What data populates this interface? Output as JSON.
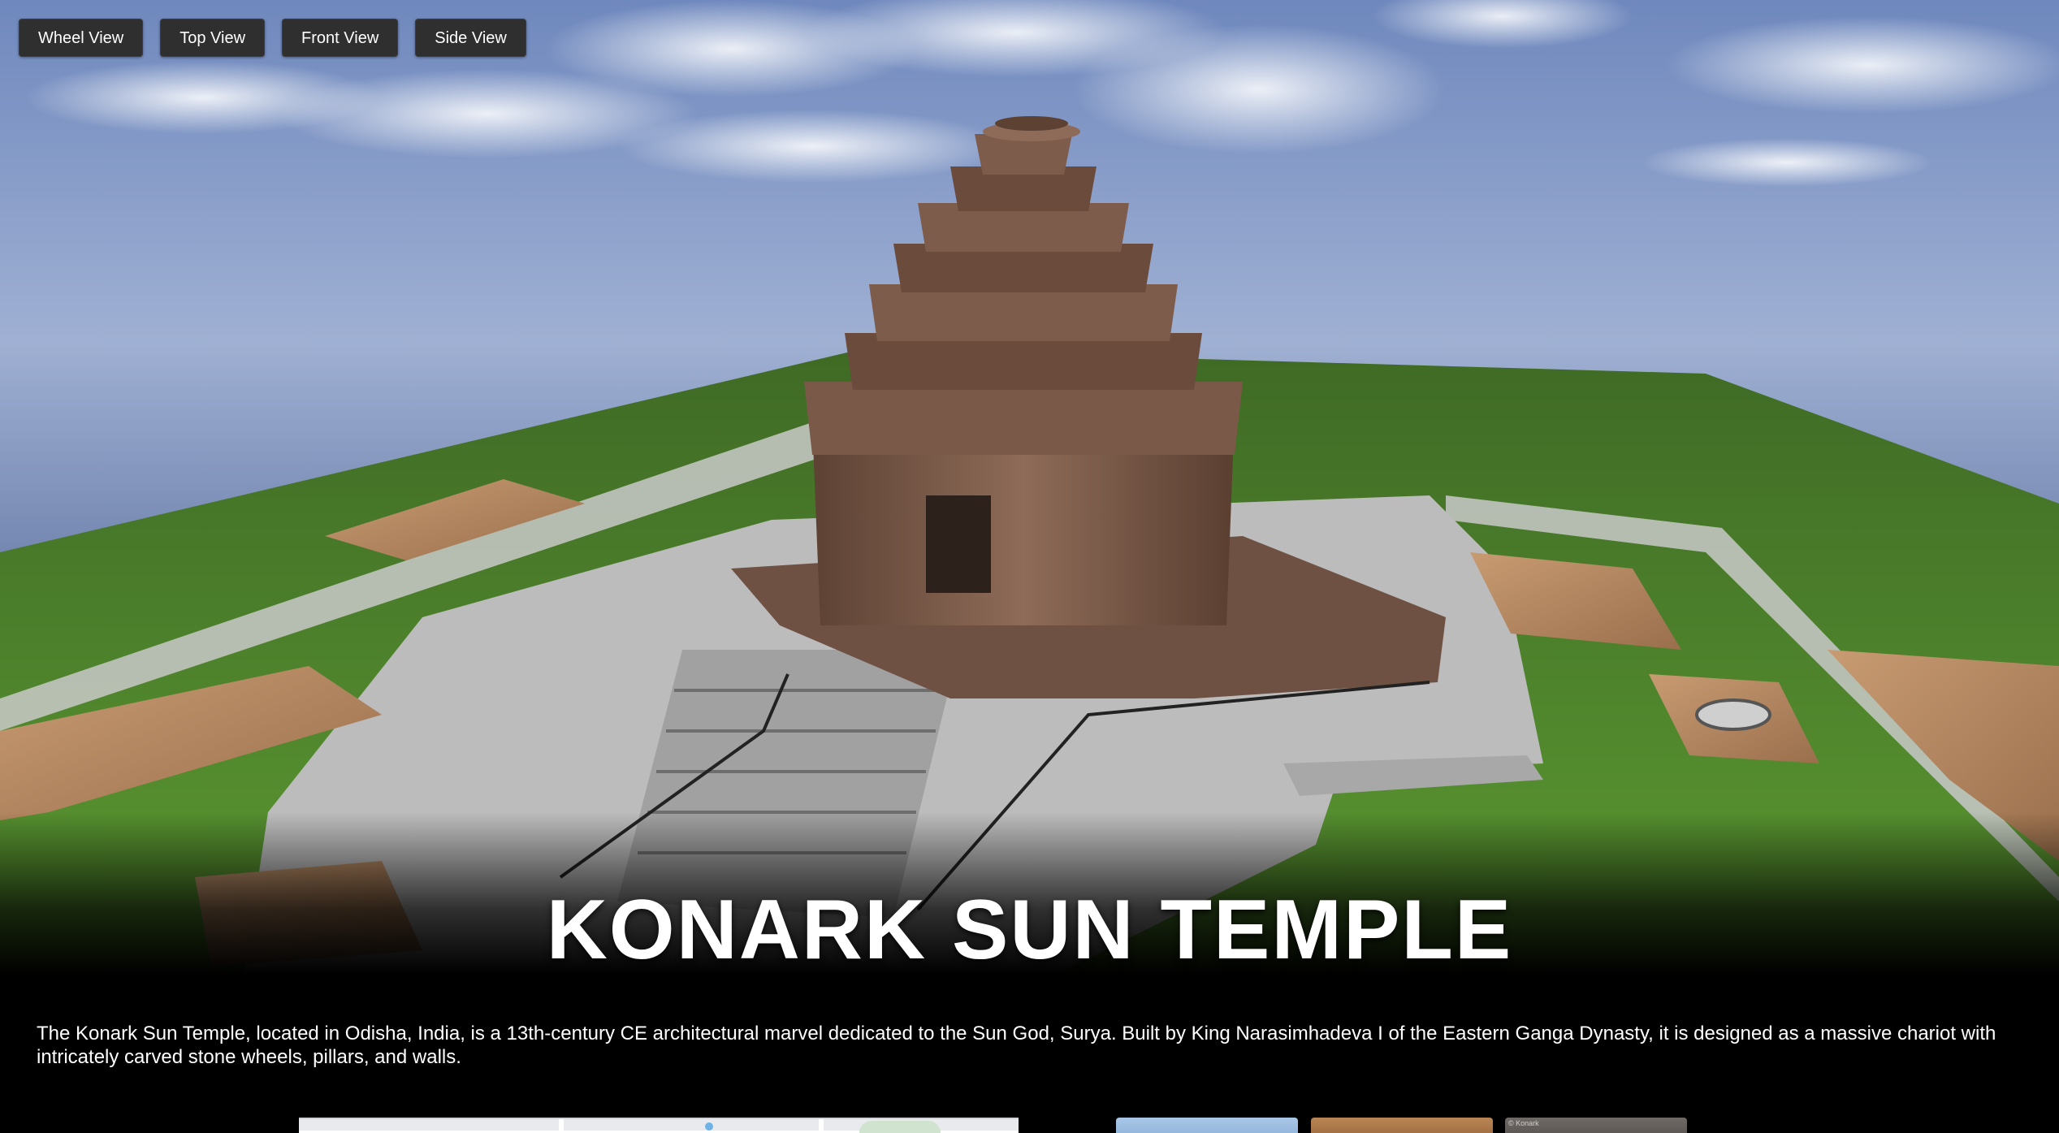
{
  "toolbar": {
    "buttons": [
      {
        "label": "Wheel View"
      },
      {
        "label": "Top View"
      },
      {
        "label": "Front View"
      },
      {
        "label": "Side View"
      }
    ]
  },
  "hero": {
    "title": "KONARK SUN TEMPLE"
  },
  "description": {
    "text": "The Konark Sun Temple, located in Odisha, India, is a 13th-century CE architectural marvel dedicated to the Sun God, Surya. Built by King Narasimhadeva I of the Eastern Ganga Dynasty, it is designed as a massive chariot with intricately carved stone wheels, pillars, and walls."
  },
  "media": {
    "thumbnails": [
      {
        "icon": "photo-thumbnail"
      },
      {
        "icon": "photo-thumbnail"
      },
      {
        "icon": "photo-thumbnail",
        "caption": "© Konark"
      }
    ]
  },
  "colors": {
    "button_bg": "#2f2f2f",
    "title": "#ffffff",
    "background": "#000000",
    "grass": "#4f8a2a",
    "stone": "#7a5a48",
    "paving": "#bdbdbd"
  }
}
